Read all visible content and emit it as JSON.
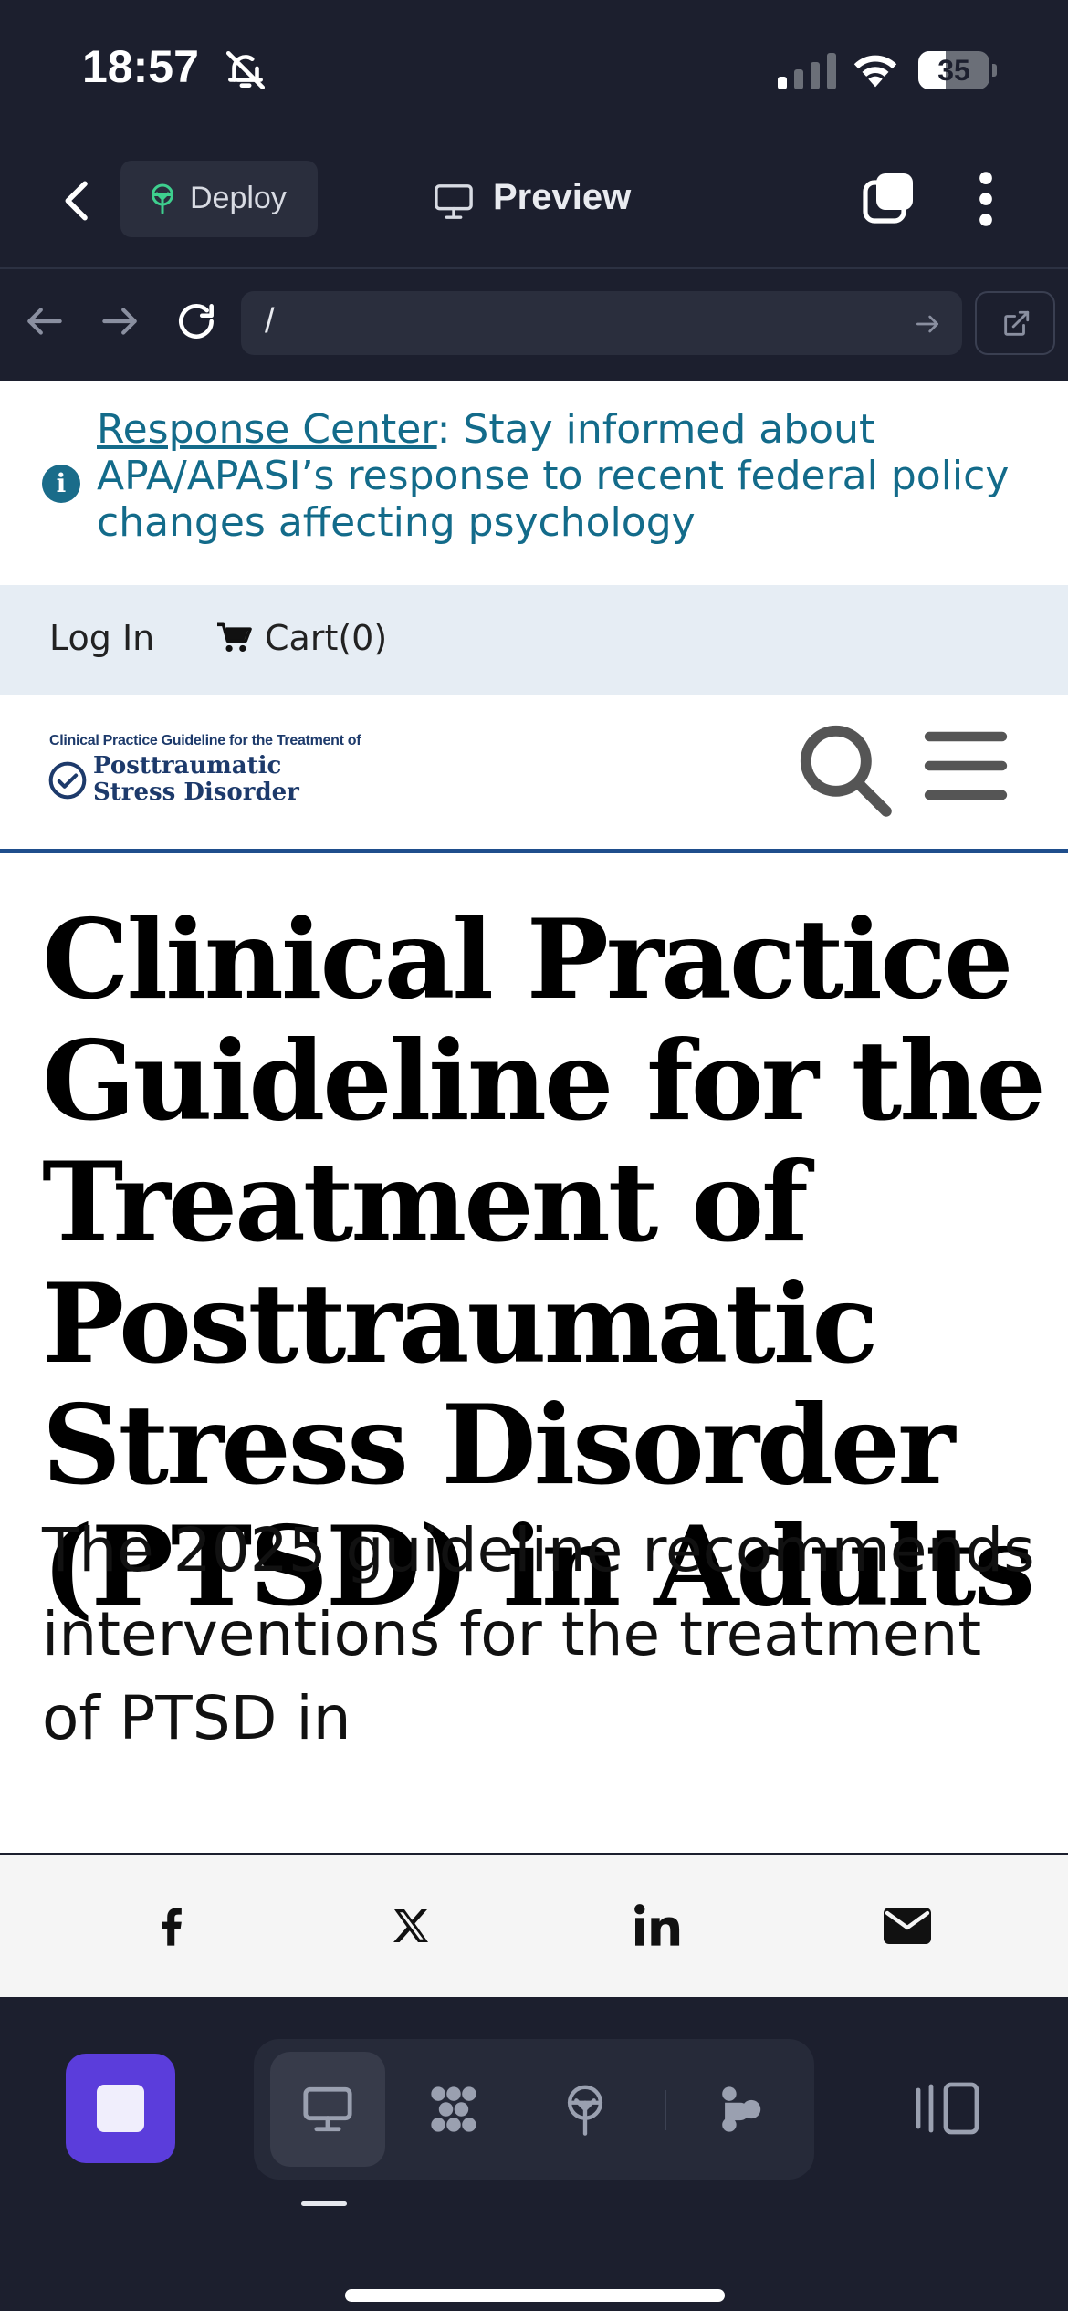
{
  "status_bar": {
    "time": "18:57",
    "battery": "35",
    "icons": [
      "bell-slash-icon",
      "signal-icon",
      "wifi-icon",
      "battery-icon"
    ]
  },
  "toolbar": {
    "deploy_label": "Deploy",
    "preview_label": "Preview",
    "icons": [
      "chevron-left-icon",
      "deploy-tree-icon",
      "monitor-icon",
      "tabs-icon",
      "more-vertical-icon"
    ]
  },
  "url_bar": {
    "url": "/",
    "icons": [
      "arrow-left-icon",
      "arrow-right-icon",
      "reload-icon",
      "arrow-right-small-icon",
      "external-link-icon"
    ]
  },
  "alert": {
    "link_text": "Response Center",
    "message": ": Stay informed about APA/APASI’s response to recent federal policy changes affecting psychology"
  },
  "utility_nav": {
    "login": "Log In",
    "cart": "Cart(0)"
  },
  "site": {
    "logo_tagline": "Clinical Practice Guideline for the Treatment of",
    "logo_line1": "Posttraumatic",
    "logo_line2": "Stress Disorder"
  },
  "main": {
    "title": "Clinical Practice Guideline for the Treatment of Posttraumatic Stress Disorder (PTSD) in Adults",
    "intro": "The 2025 guideline recommends interventions for the treatment of PTSD in"
  },
  "share": {
    "icons": [
      "facebook-icon",
      "x-icon",
      "linkedin-icon",
      "email-icon"
    ]
  },
  "bottom_bar": {
    "icons": [
      "stop-icon",
      "monitor-icon",
      "dots-grid-icon",
      "deploy-tree-icon",
      "agent-icon",
      "panel-icon"
    ],
    "active_tool": "monitor"
  },
  "colors": {
    "chrome_bg": "#1c1f2e",
    "accent_purple": "#5b3ddb",
    "alert_teal": "#136b8a",
    "brand_navy": "#1d3a6b",
    "rule_blue": "#1f4e8c"
  }
}
